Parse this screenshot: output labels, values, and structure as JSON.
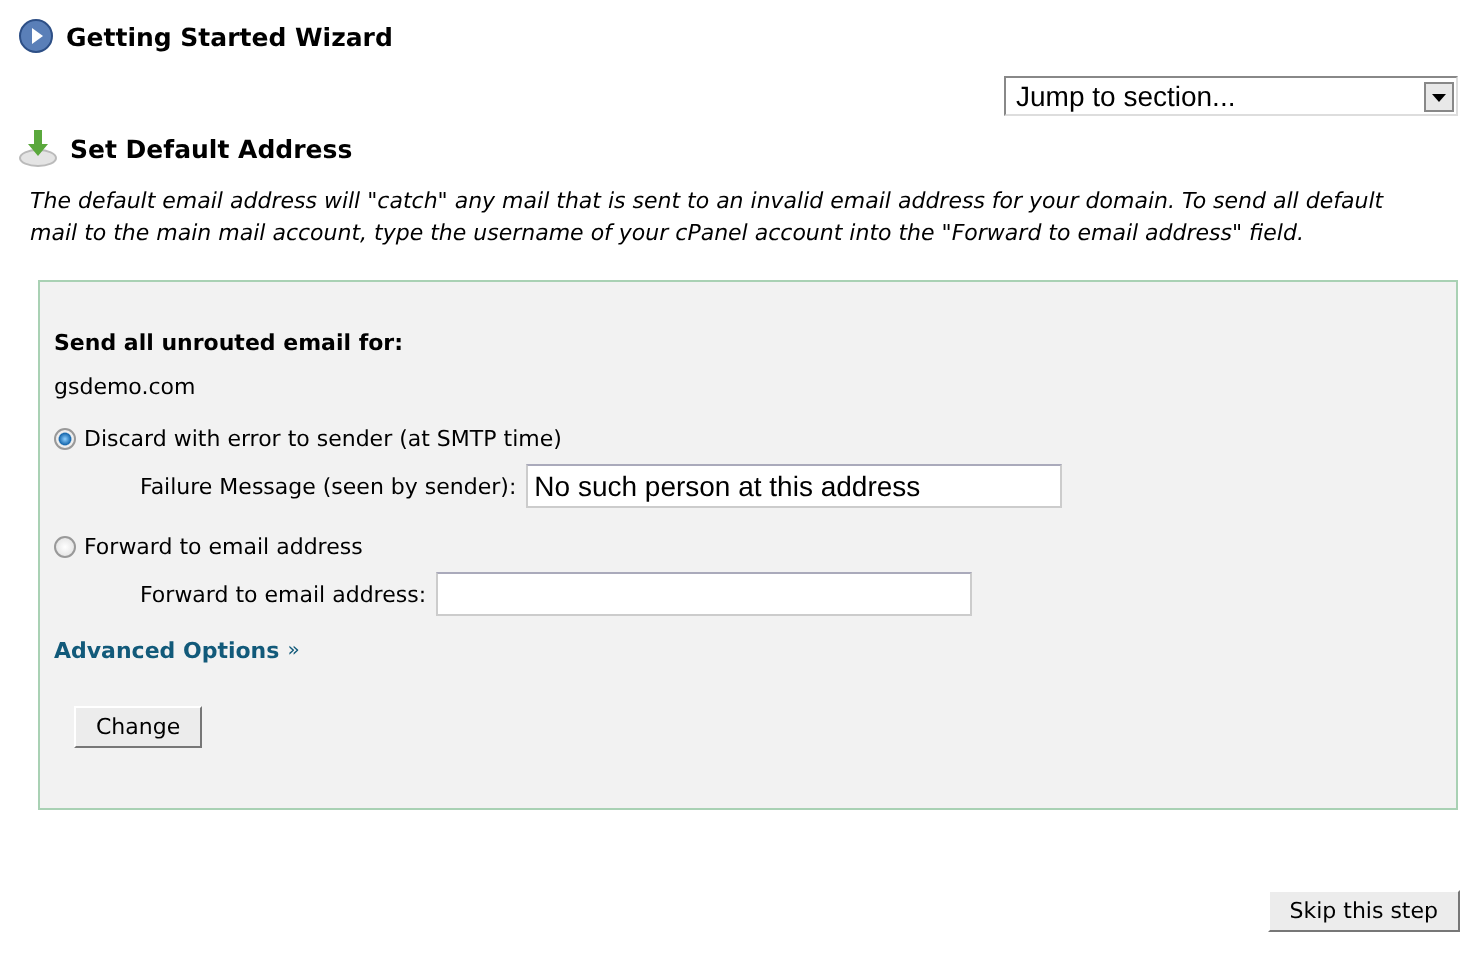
{
  "wizard_title": "Getting Started Wizard",
  "jump_select": {
    "value": "Jump to section..."
  },
  "section_title": "Set Default Address",
  "description": "The default email address will \"catch\" any mail that is sent to an invalid email address for your domain. To send all default mail to the main mail account, type the username of your cPanel account into the \"Forward to email address\" field.",
  "panel": {
    "heading": "Send all unrouted email for:",
    "domain": "gsdemo.com",
    "options": [
      {
        "label": "Discard with error to sender (at SMTP time)",
        "selected": true,
        "field_label": "Failure Message (seen by sender):",
        "value": "No such person at this address"
      },
      {
        "label": "Forward to email address",
        "selected": false,
        "field_label": "Forward to email address:"
      }
    ],
    "advanced_link": "Advanced Options",
    "advanced_arrow": "»",
    "change_button": "Change"
  },
  "skip_button": "Skip this step"
}
